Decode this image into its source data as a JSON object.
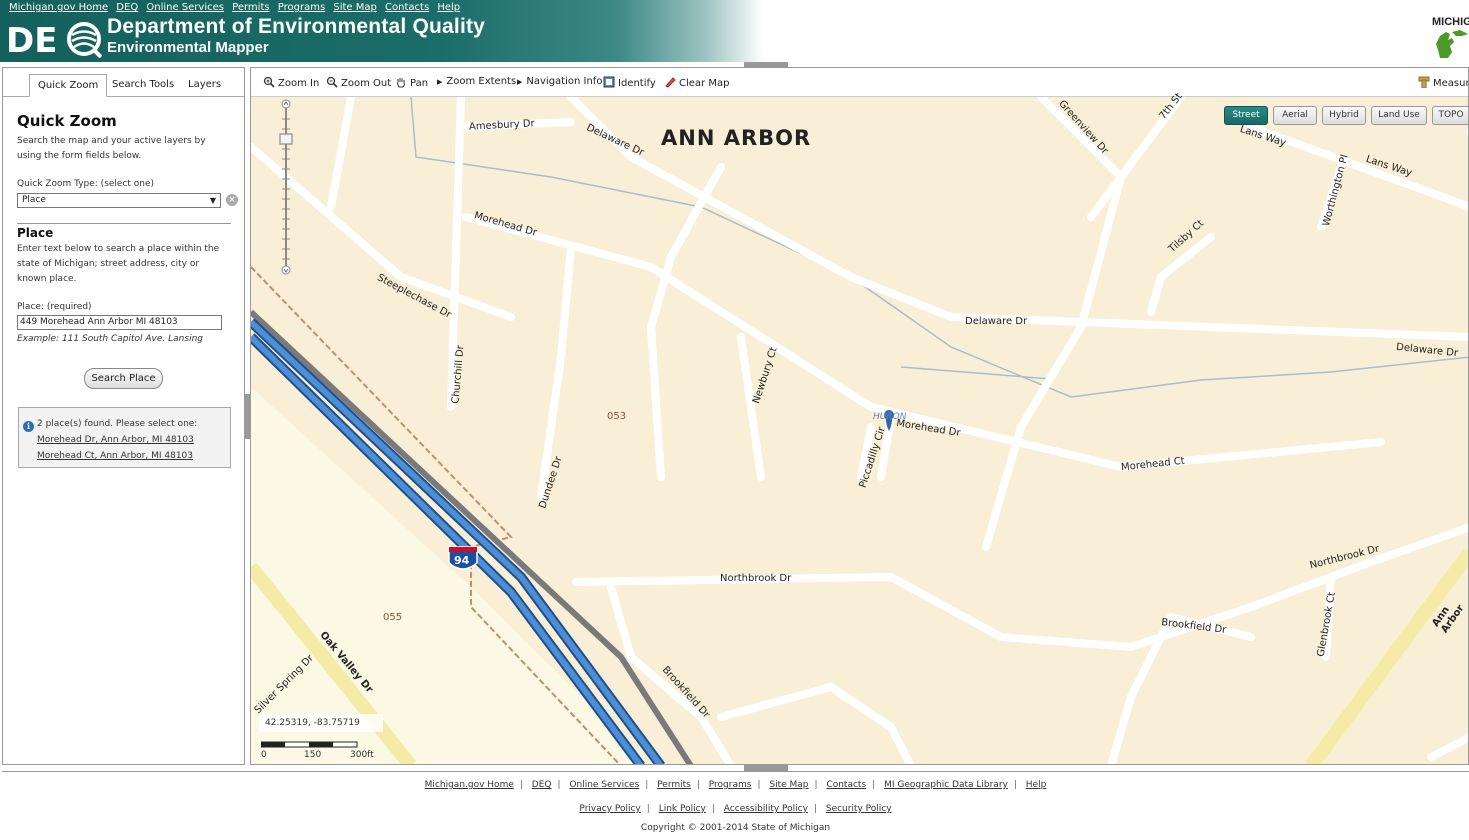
{
  "header": {
    "top_links": [
      "Michigan.gov Home",
      "DEQ",
      "Online Services",
      "Permits",
      "Programs",
      "Site Map",
      "Contacts",
      "Help"
    ],
    "title": "Department of Environmental Quality",
    "subtitle": "Environmental Mapper",
    "state_logo_text": "MICHIG"
  },
  "left_panel": {
    "tabs": [
      "Quick Zoom",
      "Search Tools",
      "Layers"
    ],
    "active_tab": "Quick Zoom",
    "title": "Quick Zoom",
    "description": "Search the map and your active layers by using the form fields below.",
    "type_label": "Quick Zoom Type: (select one)",
    "type_value": "Place",
    "place_title": "Place",
    "place_description": "Enter text below to search a place within the state of Michigan; street address, city or known place.",
    "place_label": "Place: (required)",
    "place_value": "449 Morehead Ann Arbor MI 48103",
    "place_example": "Example: 111 South Capitol Ave. Lansing",
    "search_button": "Search Place",
    "results_message": "2 place(s) found. Please select one:",
    "results": [
      "Morehead Dr, Ann Arbor, MI 48103",
      "Morehead Ct, Ann Arbor, MI 48103"
    ]
  },
  "map_toolbar": {
    "zoom_in": "Zoom In",
    "zoom_out": "Zoom Out",
    "pan": "Pan",
    "zoom_extents": "Zoom Extents",
    "navigation_info": "Navigation Info",
    "identify": "Identify",
    "clear_map": "Clear Map",
    "measure": "Measure"
  },
  "basemaps": [
    "Street",
    "Aerial",
    "Hybrid",
    "Land Use",
    "TOPO"
  ],
  "active_basemap": "Street",
  "map": {
    "city_label": "ANN ARBOR",
    "streets": [
      "Amesbury Dr",
      "Delaware Dr",
      "Greenview Dr",
      "7th St",
      "Lans Way",
      "Worthington Pl",
      "Tilsby Ct",
      "Morehead Dr",
      "Steeplechase Dr",
      "Churchill Dr",
      "Dundee Dr",
      "Newbury Ct",
      "Piccadilly Cir",
      "Morehead Ct",
      "Northbrook Dr",
      "Brookfield Dr",
      "Glenbrook Ct",
      "Oak Valley Dr",
      "Silver Spring Dr",
      "Ann Arbor"
    ],
    "area_labels": [
      "053",
      "055"
    ],
    "highway_shield": "94",
    "pin_label": "HURON",
    "coordinates": "42.25319, -83.75719",
    "scale_labels": [
      "0",
      "150",
      "300ft"
    ]
  },
  "footer": {
    "links": [
      "Michigan.gov Home",
      "DEQ",
      "Online Services",
      "Permits",
      "Programs",
      "Site Map",
      "Contacts",
      "MI Geographic Data Library",
      "Help"
    ],
    "policy_links": [
      "Privacy Policy",
      "Link Policy",
      "Accessibility Policy",
      "Security Policy"
    ],
    "copyright": "Copyright © 2001-2014 State of Michigan"
  },
  "colors": {
    "header_teal": "#14605c",
    "map_background": "#f9efd6",
    "road": "#ffffff",
    "interstate": "#3a7cc2",
    "active_basemap": "#1a7470"
  }
}
